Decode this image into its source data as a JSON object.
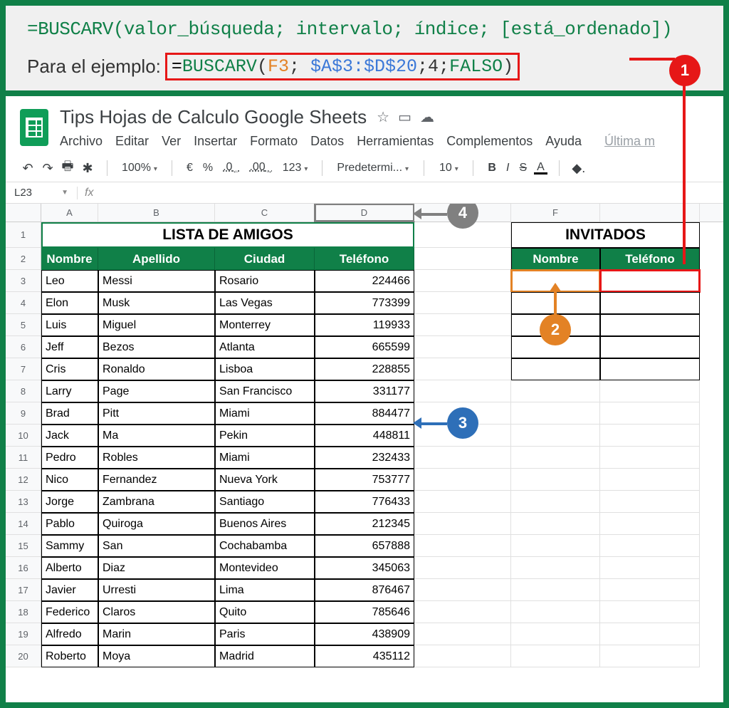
{
  "formula_syntax": "=BUSCARV(valor_búsqueda; intervalo; índice; [está_ordenado])",
  "example_label": "Para el ejemplo:",
  "formula_example": {
    "fn": "BUSCARV",
    "arg1": "F3",
    "arg2": "$A$3:$D$20",
    "arg3": "4",
    "arg4": "FALSO"
  },
  "doc_title": "Tips Hojas de Calculo Google Sheets",
  "menus": [
    "Archivo",
    "Editar",
    "Ver",
    "Insertar",
    "Formato",
    "Datos",
    "Herramientas",
    "Complementos",
    "Ayuda"
  ],
  "menu_last": "Última m",
  "toolbar": {
    "zoom": "100%",
    "currency": "€",
    "percent": "%",
    "dec_dec": ".0",
    "dec_inc": ".00",
    "num_fmt": "123",
    "font": "Predetermi...",
    "font_size": "10",
    "bold": "B",
    "italic": "I",
    "strike": "S",
    "textcolor": "A"
  },
  "namebox": "L23",
  "columns": [
    "A",
    "B",
    "C",
    "D",
    "",
    "F",
    ""
  ],
  "table1_title": "LISTA DE AMIGOS",
  "table1_headers": [
    "Nombre",
    "Apellido",
    "Ciudad",
    "Teléfono"
  ],
  "table1_rows": [
    [
      "Leo",
      "Messi",
      "Rosario",
      "224466"
    ],
    [
      "Elon",
      "Musk",
      "Las Vegas",
      "773399"
    ],
    [
      "Luis",
      "Miguel",
      "Monterrey",
      "119933"
    ],
    [
      "Jeff",
      "Bezos",
      "Atlanta",
      "665599"
    ],
    [
      "Cris",
      "Ronaldo",
      "Lisboa",
      "228855"
    ],
    [
      "Larry",
      "Page",
      "San Francisco",
      "331177"
    ],
    [
      "Brad",
      "Pitt",
      "Miami",
      "884477"
    ],
    [
      "Jack",
      "Ma",
      "Pekin",
      "448811"
    ],
    [
      "Pedro",
      "Robles",
      "Miami",
      "232433"
    ],
    [
      "Nico",
      "Fernandez",
      "Nueva York",
      "753777"
    ],
    [
      "Jorge",
      "Zambrana",
      "Santiago",
      "776433"
    ],
    [
      "Pablo",
      "Quiroga",
      "Buenos Aires",
      "212345"
    ],
    [
      "Sammy",
      "San",
      "Cochabamba",
      "657888"
    ],
    [
      "Alberto",
      "Diaz",
      "Montevideo",
      "345063"
    ],
    [
      "Javier",
      "Urresti",
      "Lima",
      "876467"
    ],
    [
      "Federico",
      "Claros",
      "Quito",
      "785646"
    ],
    [
      "Alfredo",
      "Marin",
      "Paris",
      "438909"
    ],
    [
      "Roberto",
      "Moya",
      "Madrid",
      "435112"
    ]
  ],
  "table2_title": "INVITADOS",
  "table2_headers": [
    "Nombre",
    "Teléfono"
  ],
  "callouts": {
    "c1": "1",
    "c2": "2",
    "c3": "3",
    "c4": "4"
  }
}
